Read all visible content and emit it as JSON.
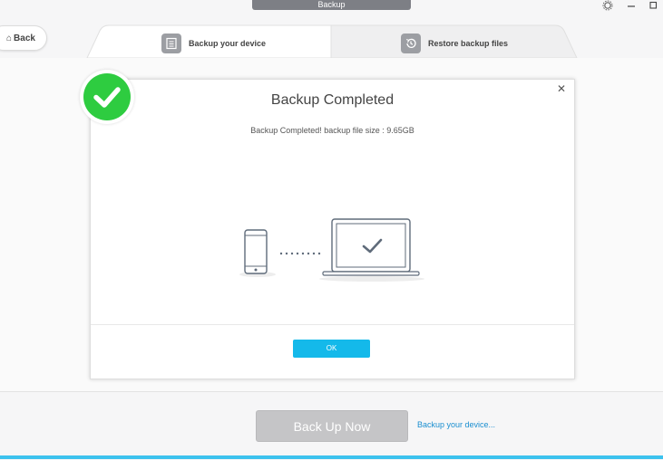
{
  "window": {
    "title": "Backup",
    "settings_icon": "gear-icon",
    "maximize_icon": "maximize-icon"
  },
  "nav": {
    "back_label": "Back"
  },
  "tabs": [
    {
      "label": "Backup your device",
      "icon": "document-list-icon"
    },
    {
      "label": "Restore backup files",
      "icon": "restore-clock-icon"
    }
  ],
  "dialog": {
    "title": "Backup Completed",
    "message": "Backup Completed! backup file size : 9.65GB",
    "ok_label": "OK",
    "close_icon": "close-icon"
  },
  "footer": {
    "backup_now_label": "Back Up Now",
    "backup_link": "Backup your device..."
  },
  "colors": {
    "accent": "#14b9ea",
    "success": "#2ecc40",
    "progress": "#3cc2ee"
  }
}
